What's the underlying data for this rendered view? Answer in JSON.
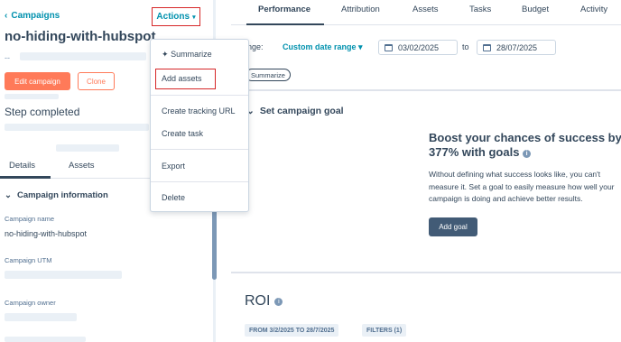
{
  "left_panel": {
    "back_label": "Campaigns",
    "campaign_title": "no-hiding-with-hubspot",
    "subtitle_dash": "--",
    "edit_button": "Edit campaign",
    "clone_button": "Clone",
    "status_text": "Step completed",
    "tabs": [
      "Details",
      "Assets"
    ],
    "section_title": "Campaign information",
    "fields": [
      {
        "label": "Campaign name",
        "value": "no-hiding-with-hubspot"
      },
      {
        "label": "Campaign UTM",
        "value": ""
      },
      {
        "label": "Campaign owner",
        "value": ""
      }
    ]
  },
  "actions_menu": {
    "button_label": "Actions",
    "items": [
      "Summarize",
      "Add assets",
      "Create tracking URL",
      "Create task",
      "Export",
      "Delete"
    ]
  },
  "right_panel": {
    "tabs": [
      "Performance",
      "Attribution",
      "Assets",
      "Tasks",
      "Budget",
      "Activity"
    ],
    "range_label": "range:",
    "range_value": "Custom date range",
    "start_date": "03/02/2025",
    "to_label": "to",
    "end_date": "28/07/2025",
    "summarize_pill": "Summarize",
    "goal_section_title": "Set campaign goal",
    "boost_heading": "Boost your chances of success by 377% with goals",
    "boost_description": "Without defining what success looks like, you can't measure it. Set a goal to easily measure how well your campaign is doing and achieve better results.",
    "add_goal_button": "Add goal",
    "roi_title": "ROI",
    "roi_date_pill": "FROM 3/2/2025 TO 28/7/2025",
    "roi_filters_pill": "FILTERS (1)"
  },
  "colors": {
    "accent_orange": "#ff7a59",
    "link_teal": "#0091ae",
    "highlight_red": "#d62728",
    "dark_button": "#425b76"
  }
}
